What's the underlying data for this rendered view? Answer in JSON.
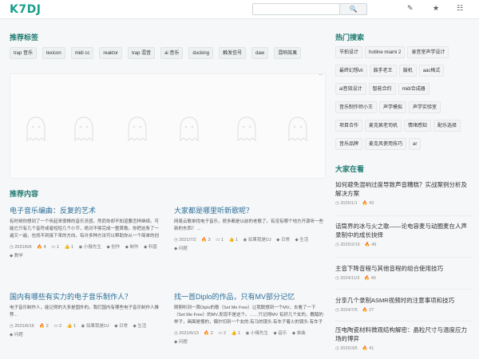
{
  "header": {
    "logo": "K7DJ",
    "search_placeholder": "",
    "search_button": "🔍",
    "icons": [
      "pen-icon",
      "star-icon",
      "menu-icon"
    ]
  },
  "sections": {
    "tags_title": "推荐标签",
    "content_title": "推荐内容",
    "hot_title": "热门搜索",
    "watch_title": "大家在看"
  },
  "tags": [
    "trap 音乐",
    "lexicon",
    "midi cc",
    "reaktor",
    "trap 混音",
    "ai 音乐",
    "ducking",
    "触发信号",
    "daw",
    "混响效果"
  ],
  "articles": [
    {
      "title": "电子音乐编曲：反复的艺术",
      "excerpt": "有时候你想到了一个听起来很棒的音乐灵感，然而你却不知道要怎样继续。可能它只有几个音符或者短短几个小节，绝对不够完成一整首歌。你把这条了一遍又一遍，也找不到接下来的方向。有许多种方法可以帮助你从一个简单的创意出发，并获得更多...",
      "date": "2021/6/6",
      "views": "4",
      "comments": "1",
      "likes": "1",
      "author": "小俄先生",
      "tags": [
        "创作",
        "制作",
        "科普",
        "教学"
      ]
    },
    {
      "title": "大家都是哪里听新歌呢？",
      "excerpt": "网易云歌单找电子音乐，很多都是以前的老歌了。有没有哪个地方开源听一些新的东西？ ...",
      "date": "2021/7/2",
      "views": "3",
      "comments": "1",
      "likes": "1",
      "author": "如果我是DJ",
      "tags": [
        "日常",
        "生活",
        "问题"
      ]
    },
    {
      "title": "国内有哪些有实力的电子音乐制作人？",
      "excerpt": "电子音乐制作人，能记得的大多是国外的。我们国内有哪些电子音乐制作人推荐...",
      "date": "2021/6/16",
      "views": "2",
      "comments": "2",
      "likes": "1",
      "author": "如果我是DJ",
      "tags": [
        "日常",
        "生活",
        "问题"
      ]
    },
    {
      "title": "找一首Diplo的作品，只有MV部分记忆",
      "excerpt": "刚刚听到一首Diplo的歌（Set Me Free）让我联想到一个MV，去看了一下（Set Me Free）的MV.发现不是这个。……只记得MV 有好几个女的，戴醋的样子，画面是慢的，偶尔切到一个女的.有马的镜头.有车子着火的镜头.有车子着火的镜头.大概和Diplo有一点关系...",
      "date": "2021/6/13",
      "views": "2",
      "comments": "2",
      "likes": "1",
      "author": "小俄先生",
      "tags": [
        "音乐",
        "单曲",
        "问题"
      ]
    }
  ],
  "hot_searches": [
    "节拍设计",
    "hotline miami 2",
    "录音室声学设计",
    "最终幻想vii",
    "鼓手老王",
    "鼓机",
    "aac格式",
    "ai音效设计",
    "智能合约",
    "midi合成器",
    "音乐制作师小王",
    "声学模拟",
    "声学实验室",
    "项目合作",
    "麦克疯老司机",
    "情绪感知",
    "配乐选择",
    "音乐品牌",
    "麦克风使用技巧",
    "ar"
  ],
  "watching": [
    {
      "title": "如何避免混响过度导致声音糟糕？实战案例分析及解决方案",
      "date": "2025/1/1",
      "count": "43"
    },
    {
      "title": "话筒界的冰与火之歌——论电容麦与动圈麦在人声录制中的成长抉择",
      "date": "2025/2/16",
      "count": "49"
    },
    {
      "title": "主音下降音程与其他音程的组合使用技巧",
      "date": "2024/11/3",
      "count": "46"
    },
    {
      "title": "分享几个录制ASMR视频时的注意事项和技巧",
      "date": "2024/7/5",
      "count": "27"
    },
    {
      "title": "压电陶瓷材料微观结构解密：晶粒尺寸与温度应力场的博弈",
      "date": "2025/3/5",
      "count": "41"
    }
  ]
}
